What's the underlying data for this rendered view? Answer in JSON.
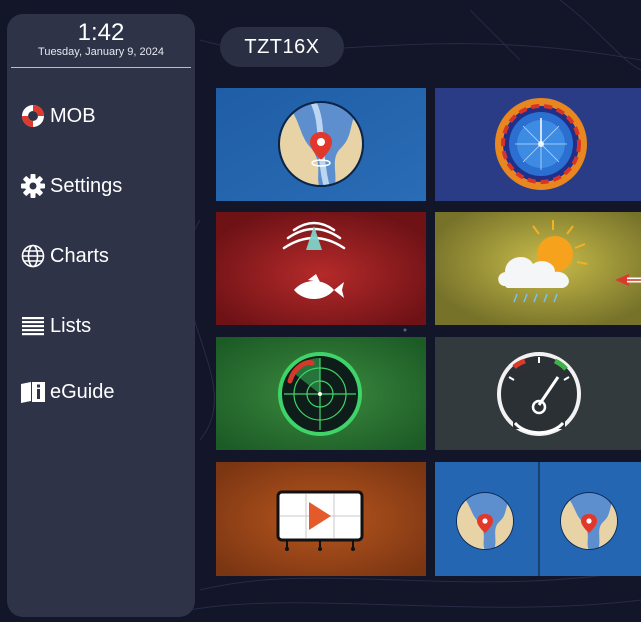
{
  "clock": {
    "time": "1:42",
    "date": "Tuesday, January 9, 2024"
  },
  "sidebar": {
    "items": [
      {
        "label": "MOB",
        "icon": "lifebuoy-icon"
      },
      {
        "label": "Settings",
        "icon": "gear-icon"
      },
      {
        "label": "Charts",
        "icon": "globe-icon"
      },
      {
        "label": "Lists",
        "icon": "list-icon"
      },
      {
        "label": "eGuide",
        "icon": "book-info-icon"
      }
    ]
  },
  "header": {
    "device_name": "TZT16X"
  },
  "tiles": [
    {
      "name": "tile-chart-plotter",
      "icon": "chart-map-pin-icon"
    },
    {
      "name": "tile-weather-radar",
      "icon": "radar-sweep-icon"
    },
    {
      "name": "tile-fish-finder",
      "icon": "fish-finder-icon"
    },
    {
      "name": "tile-weather",
      "icon": "weather-cloud-sun-icon"
    },
    {
      "name": "tile-radar",
      "icon": "radar-scope-icon"
    },
    {
      "name": "tile-instruments",
      "icon": "gauge-icon"
    },
    {
      "name": "tile-video",
      "icon": "video-play-icon"
    },
    {
      "name": "tile-split-chart",
      "icon": "split-chart-icon"
    }
  ],
  "colors": {
    "background": "#131528",
    "sidebar": "#2e3347",
    "pill": "#2b2f43",
    "accent_red": "#d93a2b",
    "radar_green": "#3fd46a"
  }
}
